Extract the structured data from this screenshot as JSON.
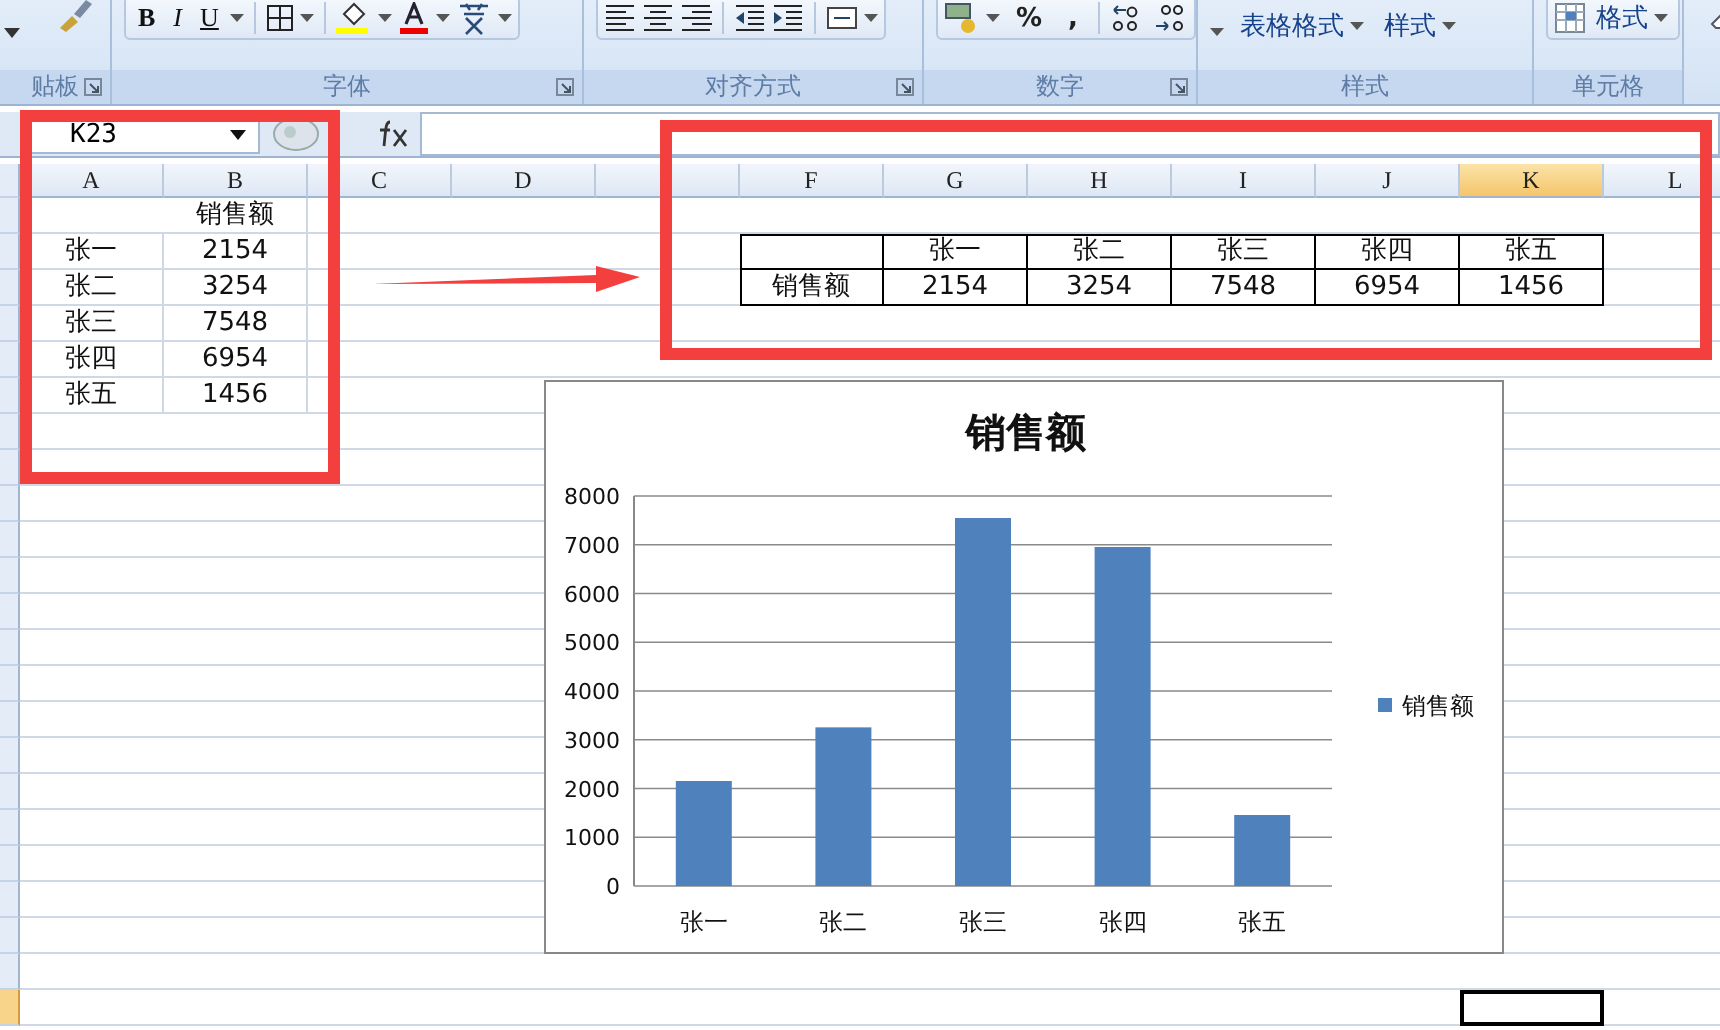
{
  "ribbon": {
    "groups": [
      {
        "kind": "clipboard",
        "label": "贴板"
      },
      {
        "kind": "font",
        "label": "字体",
        "buttons": [
          "B",
          "I",
          "U"
        ]
      },
      {
        "kind": "alignment",
        "label": "对齐方式"
      },
      {
        "kind": "number",
        "label": "数字",
        "buttons": [
          "%",
          ","
        ]
      },
      {
        "kind": "styles",
        "label": "样式",
        "buttons": [
          "表格格式",
          "样式"
        ]
      },
      {
        "kind": "cells",
        "label": "单元格",
        "buttons": [
          "格式"
        ]
      },
      {
        "kind": "editing"
      }
    ]
  },
  "formula_bar": {
    "name_box": "K23"
  },
  "sheet": {
    "columns": [
      {
        "label": "A",
        "selected": false
      },
      {
        "label": "B",
        "selected": false
      },
      {
        "label": "C",
        "selected": false
      },
      {
        "label": "D",
        "selected": false
      },
      {
        "selected": false
      },
      {
        "label": "F",
        "selected": false
      },
      {
        "label": "G",
        "selected": false
      },
      {
        "label": "H",
        "selected": false
      },
      {
        "label": "I",
        "selected": false
      },
      {
        "label": "J",
        "selected": false
      },
      {
        "label": "K",
        "selected": true
      },
      {
        "label": "L",
        "selected": false
      }
    ],
    "row_headers": [
      {
        "selected": false
      },
      {
        "selected": false
      },
      {
        "selected": false
      },
      {
        "selected": false
      },
      {
        "selected": false
      },
      {
        "selected": false
      },
      {
        "selected": false
      },
      {
        "selected": false
      },
      {
        "selected": false
      },
      {
        "selected": false
      },
      {
        "selected": false
      },
      {
        "selected": false
      },
      {
        "selected": false
      },
      {
        "selected": false
      },
      {
        "selected": false
      },
      {
        "selected": false
      },
      {
        "selected": false
      },
      {
        "selected": false
      },
      {
        "selected": false
      },
      {
        "selected": false
      },
      {
        "selected": false
      },
      {
        "selected": false
      },
      {
        "selected": true
      }
    ],
    "source_table": {
      "header": "销售额",
      "rows": [
        {
          "name": "张一",
          "value": "2154"
        },
        {
          "name": "张二",
          "value": "3254"
        },
        {
          "name": "张三",
          "value": "7548"
        },
        {
          "name": "张四",
          "value": "6954"
        },
        {
          "name": "张五",
          "value": "1456"
        }
      ]
    },
    "transposed_table": {
      "row_label": "销售额",
      "names": [
        "张一",
        "张二",
        "张三",
        "张四",
        "张五"
      ],
      "values": [
        "2154",
        "3254",
        "7548",
        "6954",
        "1456"
      ]
    }
  },
  "chart": {
    "chart_data": {
      "type": "bar",
      "title": "销售额",
      "categories": [
        "张一",
        "张二",
        "张三",
        "张四",
        "张五"
      ],
      "series": [
        {
          "name": "销售额",
          "color": "#4f81bd",
          "values": [
            2154,
            3254,
            7548,
            6954,
            1456
          ]
        }
      ],
      "ylim": [
        0,
        8000
      ],
      "grid": true,
      "yticks": [
        0,
        1000,
        2000,
        3000,
        4000,
        5000,
        6000,
        7000,
        8000
      ]
    }
  }
}
